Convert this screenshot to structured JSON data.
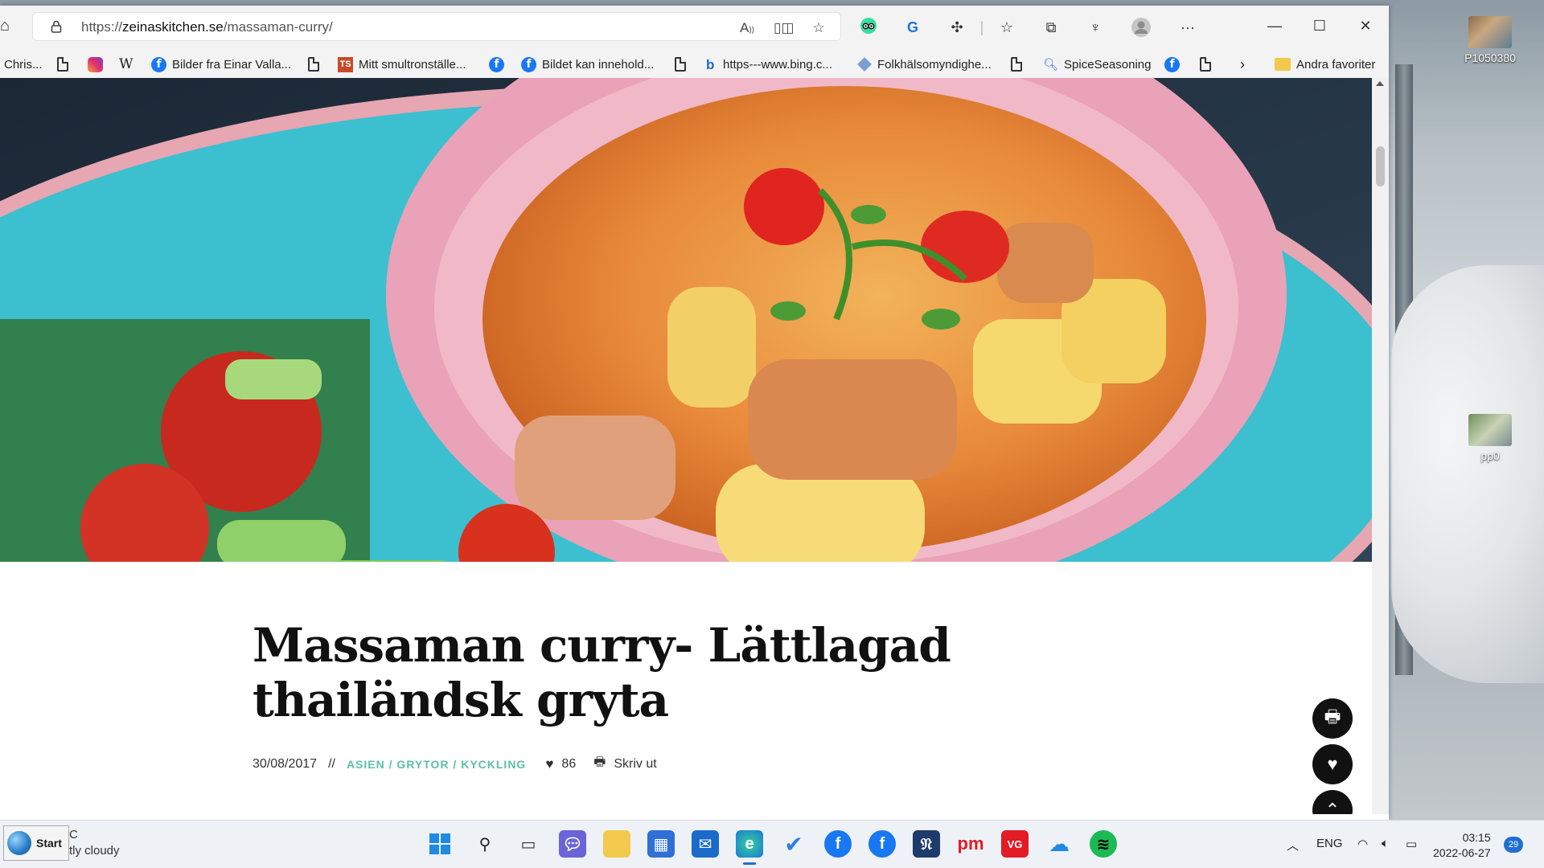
{
  "browser": {
    "url_prefix": "https://",
    "url_domain": "zeinaskitchen.se",
    "url_path": "/massaman-curry/"
  },
  "favorites": [
    {
      "label": "Chris...",
      "icon": "none"
    },
    {
      "label": "",
      "icon": "page-icon"
    },
    {
      "label": "",
      "icon": "instagram-icon"
    },
    {
      "label": "W",
      "icon": "wikipedia-icon"
    },
    {
      "label": "Bilder fra Einar Valla...",
      "icon": "facebook-icon"
    },
    {
      "label": "",
      "icon": "page-icon"
    },
    {
      "label": "Mitt smultronställe...",
      "icon": "tripadvisor-icon"
    },
    {
      "label": "",
      "icon": "facebook-icon"
    },
    {
      "label": "Bildet kan innehold...",
      "icon": "facebook-icon"
    },
    {
      "label": "",
      "icon": "page-icon"
    },
    {
      "label": "https---www.bing.c...",
      "icon": "bing-icon"
    },
    {
      "label": "Folkhälsomyndighe...",
      "icon": "folkhalsa-icon"
    },
    {
      "label": "",
      "icon": "page-icon"
    },
    {
      "label": "SpiceSeasoning",
      "icon": "search-icon"
    },
    {
      "label": "",
      "icon": "facebook-icon"
    },
    {
      "label": "",
      "icon": "page-icon"
    }
  ],
  "other_favorites": "Andra favoriter",
  "article": {
    "title": "Massaman curry- Lättlagad thailändsk gryta",
    "date": "30/08/2017",
    "separator": "//",
    "categories": "ASIEN / GRYTOR / KYCKLING",
    "likes": "86",
    "print_label": "Skriv ut"
  },
  "desktop": {
    "icons": [
      {
        "label": "P1050380"
      },
      {
        "label": "pp0"
      }
    ]
  },
  "taskbar": {
    "start_label": "Start",
    "weather_temp": "C",
    "weather_desc": "tly cloudy",
    "language": "ENG",
    "time": "03:15",
    "date": "2022-06-27",
    "notifications": "29"
  },
  "colors": {
    "accent_category": "#5bbfa7",
    "facebook": "#1877f2",
    "fab": "#111111"
  }
}
